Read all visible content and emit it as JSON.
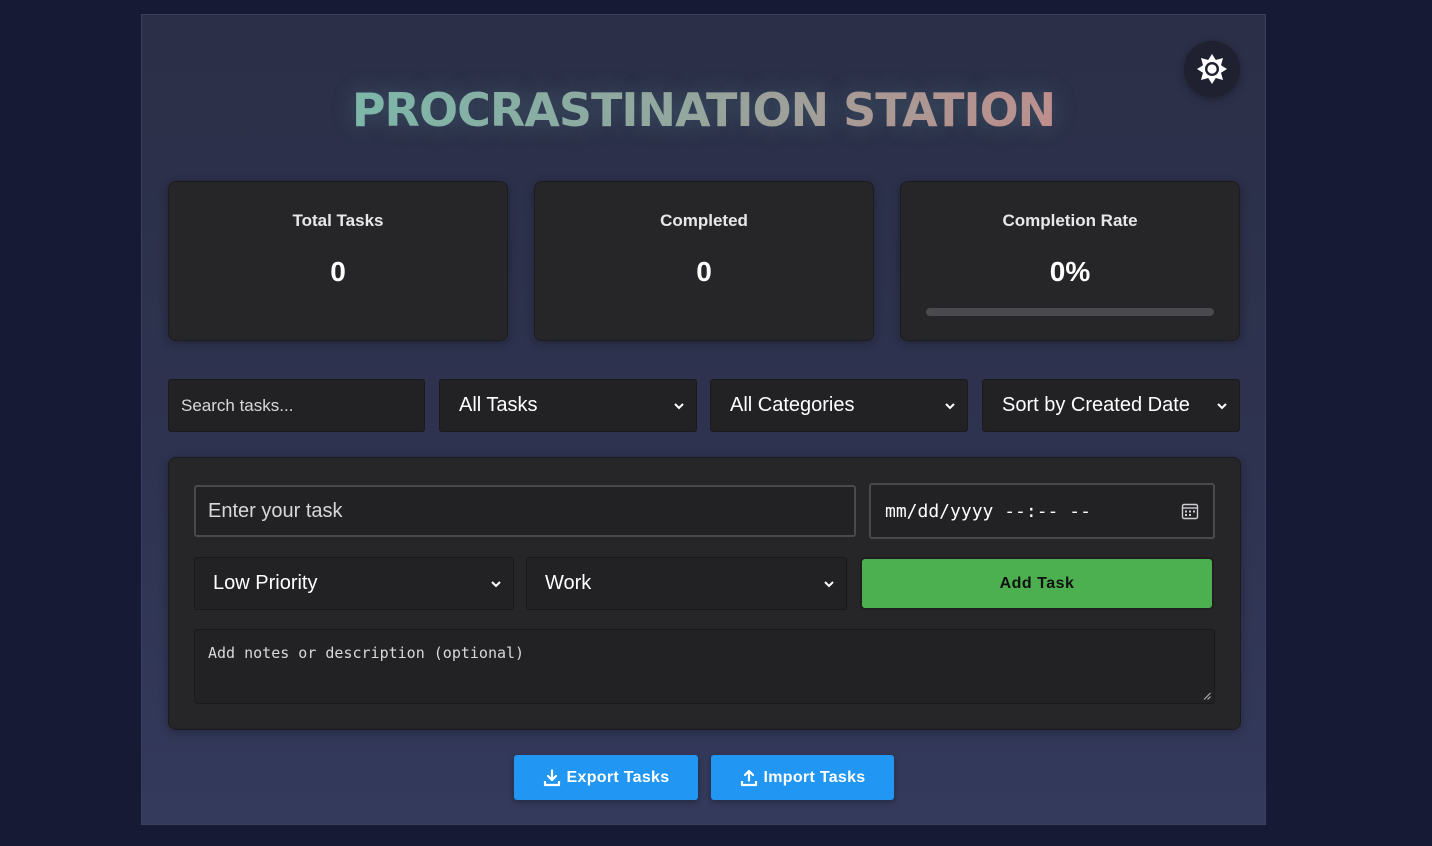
{
  "header": {
    "title": "PROCRASTINATION STATION",
    "theme_toggle_icon": "sun-icon"
  },
  "stats": [
    {
      "label": "Total Tasks",
      "value": "0"
    },
    {
      "label": "Completed",
      "value": "0"
    },
    {
      "label": "Completion Rate",
      "value": "0%"
    }
  ],
  "completion_progress": 0,
  "filters": {
    "search_placeholder": "Search tasks...",
    "status": {
      "selected": "All Tasks"
    },
    "category": {
      "selected": "All Categories"
    },
    "sort": {
      "selected": "Sort by Created Date"
    }
  },
  "form": {
    "task_placeholder": "Enter your task",
    "date_placeholder": "mm/dd/yyyy --:-- --",
    "priority": {
      "selected": "Low Priority"
    },
    "category": {
      "selected": "Work"
    },
    "add_label": "Add Task",
    "notes_placeholder": "Add notes or description (optional)"
  },
  "actions": {
    "export_label": "Export Tasks",
    "export_icon": "download-icon",
    "import_label": "Import Tasks",
    "import_icon": "upload-icon"
  },
  "colors": {
    "accent_green": "#4caf50",
    "accent_blue": "#2196f3",
    "title_gradient_start": "#6fc2b0",
    "title_gradient_end": "#e07a7e"
  }
}
